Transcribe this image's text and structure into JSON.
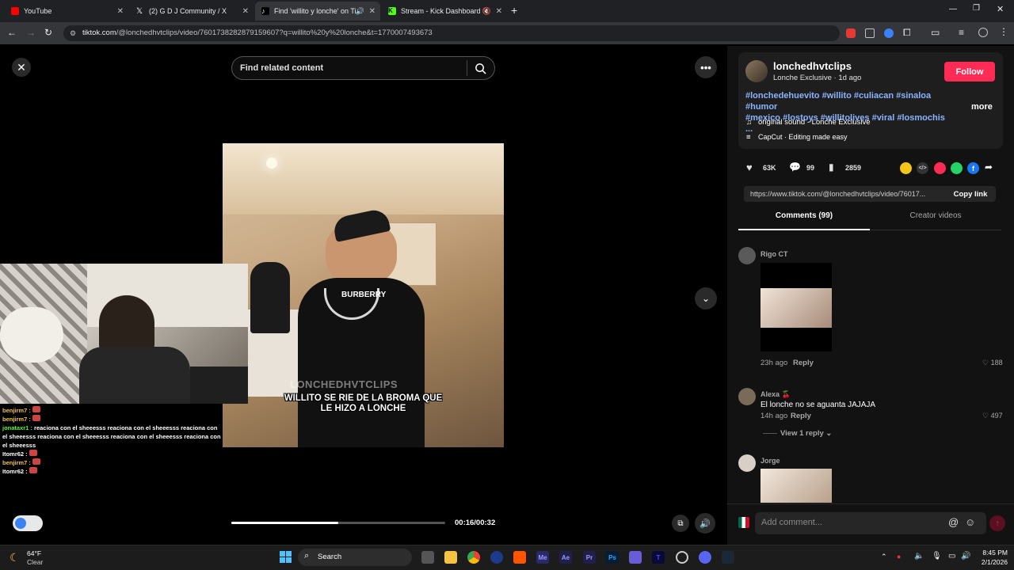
{
  "tabs": [
    {
      "label": "YouTube",
      "color": "#ff0000"
    },
    {
      "label": "(2) G D J Community / X",
      "color": "#ffffff"
    },
    {
      "label": "Find 'willito y lonche' on Ti",
      "color": "#ffffff"
    },
    {
      "label": "Stream - Kick Dashboard",
      "color": "#53fc18"
    }
  ],
  "address": {
    "host": "tiktok.com",
    "path": "/@lonchedhvtclips/video/7601738282879159607?q=willito%20y%20lonche&t=1770007493673"
  },
  "search": {
    "placeholder": "Find related content"
  },
  "video": {
    "watermark": "LONCHEDHVTCLIPS",
    "caption_line1": "WILLITO SE RIE DE LA BROMA QUE",
    "caption_line2": "LE HIZO A LONCHE",
    "shirt_text": "BURBERRY",
    "time": "00:16/00:32",
    "progress": 0.5
  },
  "author": {
    "username": "lonchedhvtclips",
    "subtitle": "Lonche Exclusive · 1d ago",
    "follow_label": "Follow"
  },
  "description": {
    "line1": "#lonchedehuevito #willito #culiacan #sinaloa #humor",
    "line2": "#mexico #lostoys #willitolives #viral #losmochis ...",
    "more_label": "more"
  },
  "sound": {
    "label": "original sound - Lonche Exclusive"
  },
  "capcut": {
    "label": "CapCut · Editing made easy"
  },
  "stats": {
    "likes": "63K",
    "comments": "99",
    "saves": "2859"
  },
  "link": {
    "url": "https://www.tiktok.com/@lonchedhvtclips/video/76017...",
    "copy_label": "Copy link"
  },
  "panel_tabs": {
    "comments": "Comments (99)",
    "creator": "Creator videos"
  },
  "comments": [
    {
      "name": "Rigo CT",
      "time": "23h ago",
      "reply": "Reply",
      "likes": "188"
    },
    {
      "name": "Alexa 🍒",
      "text": "El lonche no se aguanta JAJAJA",
      "time": "14h ago",
      "reply": "Reply",
      "likes": "497",
      "view_replies": "View 1 reply"
    },
    {
      "name": "Jorge"
    }
  ],
  "add_comment": {
    "placeholder": "Add comment..."
  },
  "chat": [
    {
      "user": "benjirm7 :",
      "color": "#f5c242",
      "msg": ""
    },
    {
      "user": "benjirm7 :",
      "color": "#f5c242",
      "msg": ""
    },
    {
      "user": "jonataxr1 :",
      "color": "#53fc18",
      "msg": "reaciona con el sheeesss  reaciona con el sheeesss  reaciona con el sheeesss  reaciona con el sheeesss  reaciona con el sheeesss  reaciona con el sheeesss"
    },
    {
      "user": "Itomr62 :",
      "color": "#ffffff",
      "msg": ""
    },
    {
      "user": "benjirm7 :",
      "color": "#f5c242",
      "msg": ""
    },
    {
      "user": "Itomr62 :",
      "color": "#ffffff",
      "msg": ""
    }
  ],
  "taskbar": {
    "weather_temp": "64°F",
    "weather_cond": "Clear",
    "search_label": "Search",
    "time": "8:45 PM",
    "date": "2/1/2026"
  }
}
